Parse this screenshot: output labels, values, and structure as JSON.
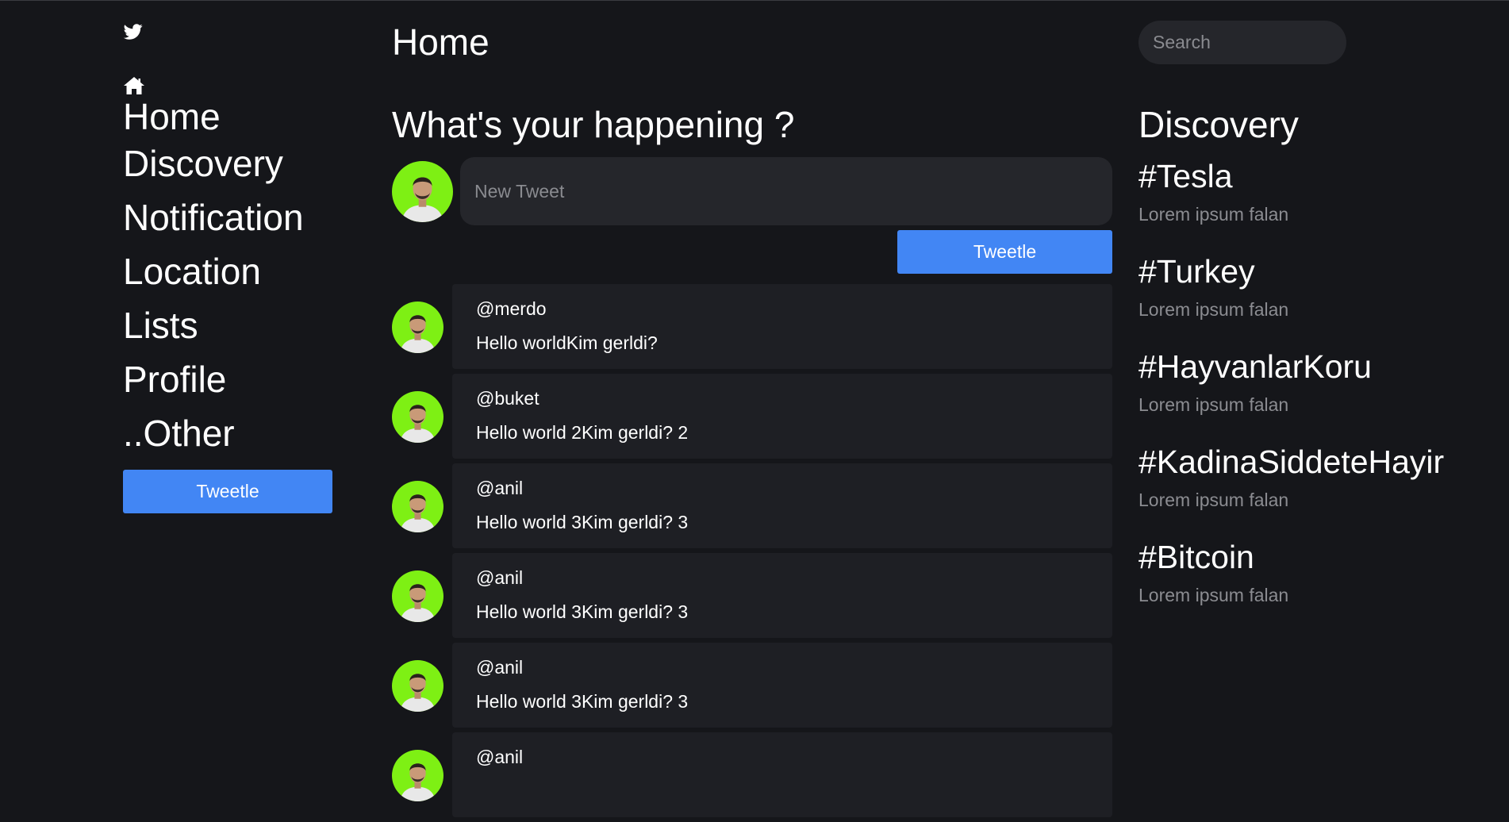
{
  "sidebar": {
    "logo": "twitter-bird-icon",
    "home_icon": "home-icon",
    "items": [
      {
        "label": "Home"
      },
      {
        "label": "Discovery"
      },
      {
        "label": "Notification"
      },
      {
        "label": "Location"
      },
      {
        "label": "Lists"
      },
      {
        "label": "Profile"
      },
      {
        "label": "..Other"
      }
    ],
    "tweet_button": "Tweetle"
  },
  "header": {
    "title": "Home"
  },
  "composer": {
    "title": "What's your happening ?",
    "placeholder": "New Tweet",
    "button": "Tweetle",
    "avatar": "avatar-icon"
  },
  "feed": [
    {
      "user": "@merdo",
      "text": "Hello worldKim gerldi?"
    },
    {
      "user": "@buket",
      "text": "Hello world 2Kim gerldi? 2"
    },
    {
      "user": "@anil",
      "text": "Hello world 3Kim gerldi? 3"
    },
    {
      "user": "@anil",
      "text": "Hello world 3Kim gerldi? 3"
    },
    {
      "user": "@anil",
      "text": "Hello world 3Kim gerldi? 3"
    },
    {
      "user": "@anil",
      "text": ""
    }
  ],
  "search": {
    "placeholder": "Search"
  },
  "discovery": {
    "title": "Discovery",
    "trends": [
      {
        "tag": "#Tesla",
        "desc": "Lorem ipsum falan"
      },
      {
        "tag": "#Turkey",
        "desc": "Lorem ipsum falan"
      },
      {
        "tag": "#HayvanlarKoru",
        "desc": "Lorem ipsum falan"
      },
      {
        "tag": "#KadinaSiddeteHayir",
        "desc": "Lorem ipsum falan"
      },
      {
        "tag": "#Bitcoin",
        "desc": "Lorem ipsum falan"
      }
    ]
  },
  "colors": {
    "background": "#15161a",
    "card": "#1e1f24",
    "input": "#25262b",
    "accent": "#4286f4",
    "avatar_bg": "#7ef014",
    "muted_text": "#8b8c91"
  }
}
